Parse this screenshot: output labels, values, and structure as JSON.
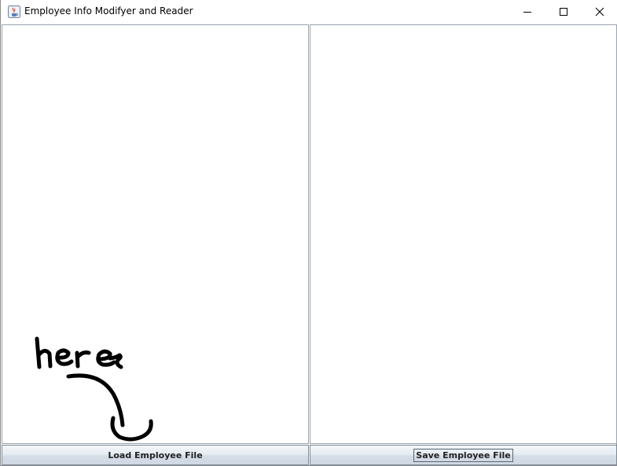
{
  "window": {
    "title": "Employee Info Modifyer and Reader",
    "icon": "java-cup-icon"
  },
  "titlebar_controls": {
    "minimize_icon": "minimize-icon",
    "maximize_icon": "maximize-icon",
    "close_icon": "close-icon"
  },
  "buttons": {
    "load_label": "Load Employee File",
    "save_label": "Save Employee File"
  },
  "annotation": {
    "handwritten_text": "here",
    "arrow_icon": "hand-drawn-arrow-icon",
    "color": "#000000"
  },
  "colors": {
    "panel_border": "#9aa4ae",
    "button_gradient_top": "#f3f6fa",
    "button_gradient_bottom": "#cfd8e3"
  }
}
